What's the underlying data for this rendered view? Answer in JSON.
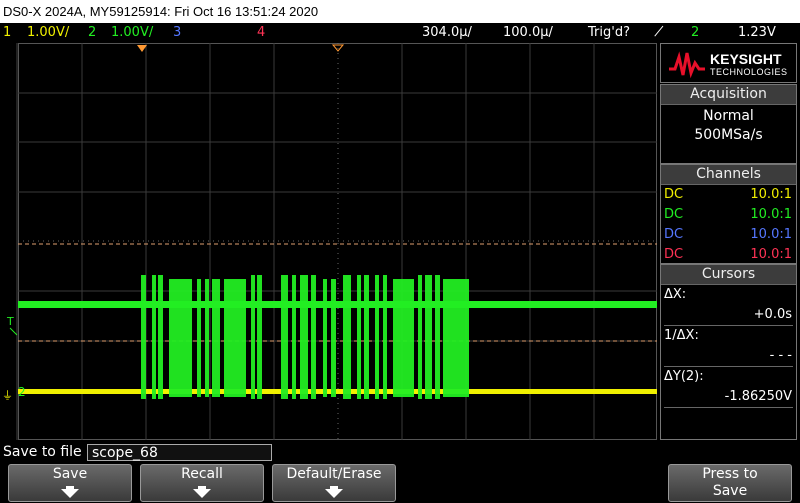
{
  "title": "DS0-X 2024A, MY59125914: Fri Oct 16 13:51:24 2020",
  "status": {
    "ch1_num": "1",
    "ch1_scale": "1.00V/",
    "ch2_num": "2",
    "ch2_scale": "1.00V/",
    "ch3_num": "3",
    "ch4_num": "4",
    "time_scale": "304.0µ/",
    "delay": "100.0µ/",
    "trig_state": "Trig'd?",
    "trig_symbol": "̸",
    "trig_channel": "2",
    "trig_level": "1.23V"
  },
  "logo": {
    "brand": "KEYSIGHT",
    "sub": "TECHNOLOGIES"
  },
  "acquisition": {
    "header": "Acquisition",
    "mode": "Normal",
    "rate": "500MSa/s"
  },
  "channels": {
    "header": "Channels",
    "rows": [
      {
        "coupling": "DC",
        "probe": "10.0:1",
        "color": "#f0f000"
      },
      {
        "coupling": "DC",
        "probe": "10.0:1",
        "color": "#22ee22"
      },
      {
        "coupling": "DC",
        "probe": "10.0:1",
        "color": "#5577ff"
      },
      {
        "coupling": "DC",
        "probe": "10.0:1",
        "color": "#ff3355"
      }
    ]
  },
  "cursors": {
    "header": "Cursors",
    "dx_label": "ΔX:",
    "dx_value": "+0.0s",
    "inv_label": "1/ΔX:",
    "inv_value": "- - -",
    "dy_label": "ΔY(2):",
    "dy_value": "-1.86250V"
  },
  "markers": {
    "trigger": "T",
    "ch2_marker": "2"
  },
  "save": {
    "label": "Save to file =",
    "filename": "scope_68"
  },
  "softkeys": {
    "save": "Save",
    "recall": "Recall",
    "default_erase": "Default/Erase",
    "press_to": "Press to",
    "press_save": "Save"
  },
  "colors": {
    "ch1": "#f0f000",
    "ch2": "#22ee22",
    "ch3": "#5577ff",
    "ch4": "#ff3355",
    "cursor": "#e0a070",
    "trigger_marker": "#ff9933"
  }
}
